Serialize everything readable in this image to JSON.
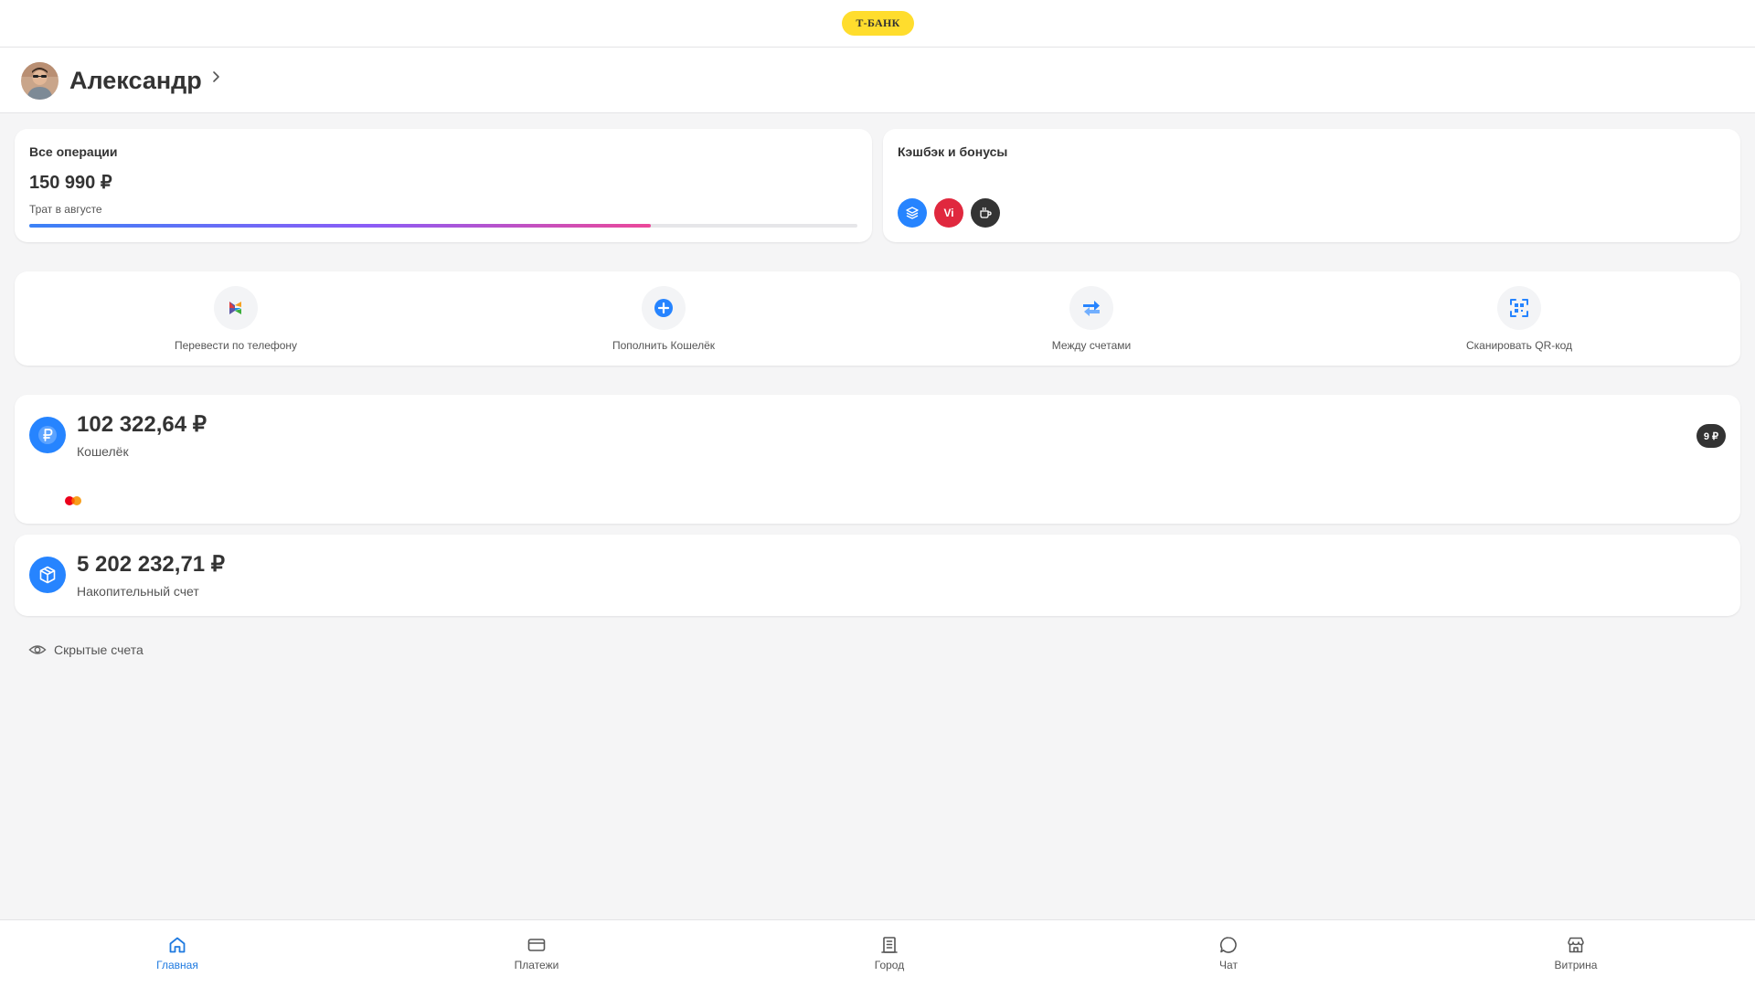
{
  "header": {
    "logo_text": "Т-БАНК",
    "logo_color": "#ffdd2d"
  },
  "profile": {
    "name": "Александр"
  },
  "operations": {
    "title": "Все операции",
    "amount": "150 990 ₽",
    "caption": "Трат в августе",
    "progress": 0.75
  },
  "cashback": {
    "title": "Кэшбэк и бонусы",
    "icons": [
      {
        "icon": "layers-icon",
        "color": "#2684ff"
      },
      {
        "icon": "vi-icon",
        "text": "Vi",
        "color": "#e0283e"
      },
      {
        "icon": "coffee-icon",
        "color": "#333333"
      }
    ]
  },
  "actions": [
    {
      "label": "Перевести по телефону",
      "icon": "sbp-icon"
    },
    {
      "label": "Пополнить Кошелёк",
      "icon": "plus-icon"
    },
    {
      "label": "Между счетами",
      "icon": "transfer-arrows-icon"
    },
    {
      "label": "Сканировать QR-код",
      "icon": "qr-scan-icon"
    }
  ],
  "accounts": [
    {
      "amount": "102 322,64 ₽",
      "name": "Кошелёк",
      "badge": "9 ₽",
      "icon": "ruble-icon",
      "card_icon": "mastercard-icon"
    },
    {
      "amount": "5 202 232,71 ₽",
      "name": "Накопительный счет",
      "icon": "box-icon"
    }
  ],
  "hidden_accounts": {
    "label": "Скрытые счета"
  },
  "nav": {
    "active_color": "#1f7ae0",
    "items": [
      {
        "label": "Главная",
        "icon": "home-icon",
        "active": true
      },
      {
        "label": "Платежи",
        "icon": "card-icon"
      },
      {
        "label": "Город",
        "icon": "city-icon"
      },
      {
        "label": "Чат",
        "icon": "chat-icon"
      },
      {
        "label": "Витрина",
        "icon": "store-icon"
      }
    ]
  }
}
